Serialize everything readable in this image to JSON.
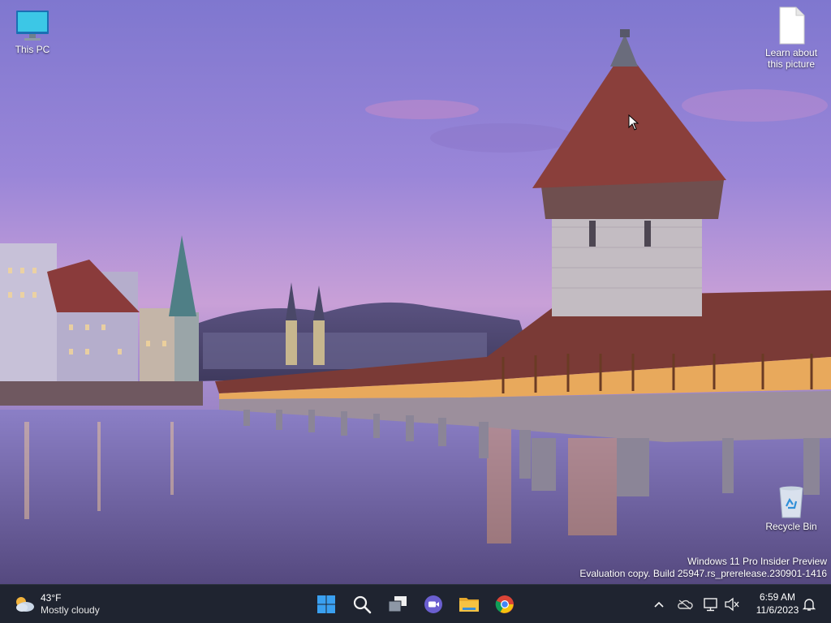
{
  "desktop": {
    "icons": [
      {
        "label": "This PC",
        "icon": "monitor-icon"
      },
      {
        "label": "Learn about this picture",
        "icon": "document-icon"
      },
      {
        "label": "Recycle Bin",
        "icon": "recycle-bin-icon"
      }
    ],
    "watermark": {
      "line1": "Windows 11 Pro Insider Preview",
      "line2": "Evaluation copy. Build 25947.rs_prerelease.230901-1416"
    }
  },
  "taskbar": {
    "weather": {
      "temp": "43°F",
      "condition": "Mostly cloudy",
      "icon": "partly-cloudy-icon"
    },
    "apps": [
      {
        "name": "Start",
        "icon": "windows-start-icon"
      },
      {
        "name": "Search",
        "icon": "search-icon"
      },
      {
        "name": "Task View",
        "icon": "task-view-icon"
      },
      {
        "name": "Meet",
        "icon": "video-chat-icon"
      },
      {
        "name": "File Explorer",
        "icon": "folder-icon"
      },
      {
        "name": "Google Chrome",
        "icon": "chrome-icon"
      }
    ],
    "tray": {
      "icons": [
        "chevron-up-icon",
        "onedrive-icon",
        "network-icon",
        "speaker-muted-icon",
        "notification-bell-icon"
      ]
    },
    "clock": {
      "time": "6:59 AM",
      "date": "11/6/2023"
    }
  },
  "colors": {
    "taskbar_bg": "#1f2430",
    "accent_blue": "#3aa0f0",
    "folder_yellow": "#f5c242"
  }
}
